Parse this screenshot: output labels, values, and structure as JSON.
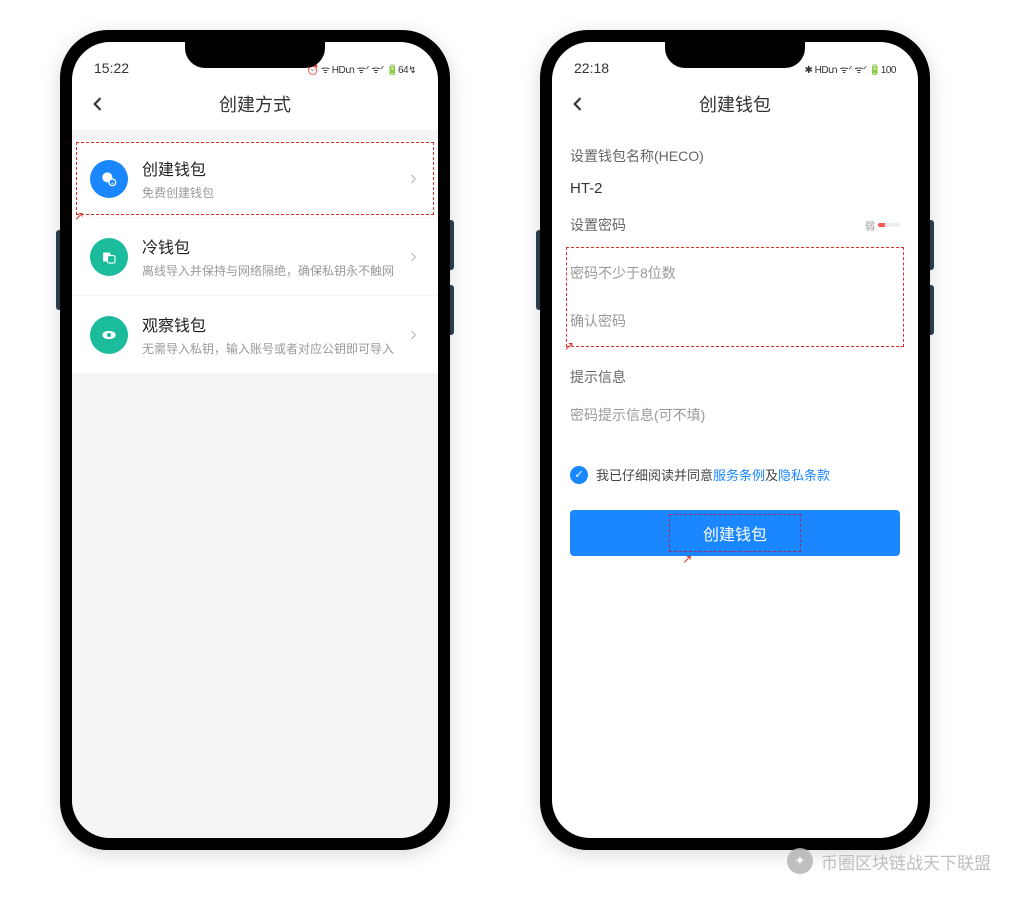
{
  "watermark": "币圈区块链战天下联盟",
  "phone1": {
    "time": "15:22",
    "status": "⏰ ᯤ HDտ ᯤᐟ ᯤᐟ 🔋64↯",
    "title": "创建方式",
    "rows": [
      {
        "title": "创建钱包",
        "sub": "免费创建钱包"
      },
      {
        "title": "冷钱包",
        "sub": "离线导入并保持与网络隔绝，确保私钥永不触网"
      },
      {
        "title": "观察钱包",
        "sub": "无需导入私钥，输入账号或者对应公钥即可导入"
      }
    ]
  },
  "phone2": {
    "time": "22:18",
    "status": "✱ HDտ ᯤᐟ ᯤᐟ 🔋100",
    "title": "创建钱包",
    "name_label": "设置钱包名称(HECO)",
    "name_value": "HT-2",
    "pwd_label": "设置密码",
    "strength_label": "弱",
    "pwd_placeholder": "密码不少于8位数",
    "confirm_placeholder": "确认密码",
    "hint_label": "提示信息",
    "hint_placeholder": "密码提示信息(可不填)",
    "agree_pre": "我已仔细阅读并同意",
    "terms": "服务条例",
    "and": "及",
    "privacy": "隐私条款",
    "button": "创建钱包"
  }
}
